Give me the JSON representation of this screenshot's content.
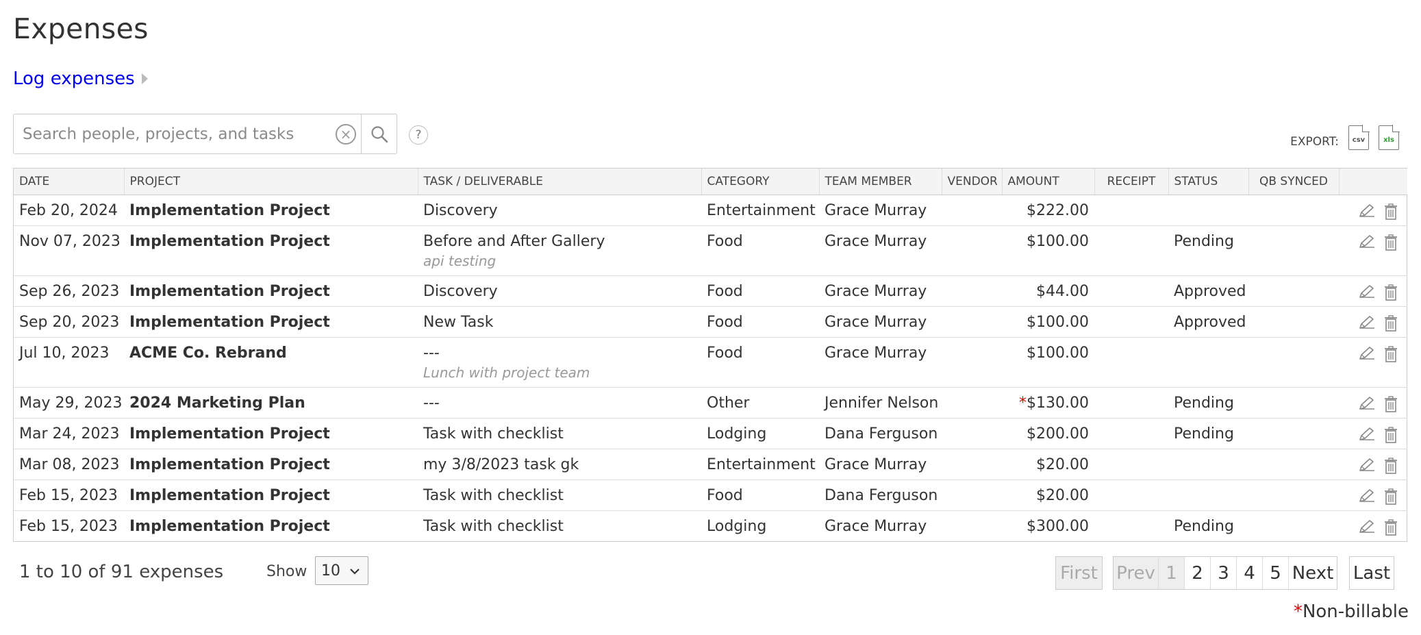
{
  "page": {
    "title": "Expenses",
    "log_link": "Log expenses"
  },
  "search": {
    "placeholder": "Search people, projects, and tasks",
    "help": "?"
  },
  "export": {
    "label": "EXPORT:",
    "csv": "csv",
    "xls": "xls"
  },
  "table": {
    "columns": {
      "date": "DATE",
      "project": "PROJECT",
      "task": "TASK / DELIVERABLE",
      "category": "CATEGORY",
      "member": "TEAM MEMBER",
      "vendor": "VENDOR",
      "amount": "AMOUNT",
      "receipt": "RECEIPT",
      "status": "STATUS",
      "qb": "QB SYNCED"
    },
    "rows": [
      {
        "date": "Feb 20, 2024",
        "project": "Implementation Project",
        "task": "Discovery",
        "note": "",
        "category": "Entertainment",
        "member": "Grace Murray",
        "vendor": "",
        "nonbillable": "",
        "amount": "$222.00",
        "receipt": "",
        "status": "",
        "qb": ""
      },
      {
        "date": "Nov 07, 2023",
        "project": "Implementation Project",
        "task": "Before and After Gallery",
        "note": "api testing",
        "category": "Food",
        "member": "Grace Murray",
        "vendor": "",
        "nonbillable": "",
        "amount": "$100.00",
        "receipt": "",
        "status": "Pending",
        "qb": ""
      },
      {
        "date": "Sep 26, 2023",
        "project": "Implementation Project",
        "task": "Discovery",
        "note": "",
        "category": "Food",
        "member": "Grace Murray",
        "vendor": "",
        "nonbillable": "",
        "amount": "$44.00",
        "receipt": "",
        "status": "Approved",
        "qb": ""
      },
      {
        "date": "Sep 20, 2023",
        "project": "Implementation Project",
        "task": "New Task",
        "note": "",
        "category": "Food",
        "member": "Grace Murray",
        "vendor": "",
        "nonbillable": "",
        "amount": "$100.00",
        "receipt": "",
        "status": "Approved",
        "qb": ""
      },
      {
        "date": "Jul 10, 2023",
        "project": "ACME Co. Rebrand",
        "task": "---",
        "note": "Lunch with project team",
        "category": "Food",
        "member": "Grace Murray",
        "vendor": "",
        "nonbillable": "",
        "amount": "$100.00",
        "receipt": "",
        "status": "",
        "qb": ""
      },
      {
        "date": "May 29, 2023",
        "project": "2024 Marketing Plan",
        "task": "---",
        "note": "",
        "category": "Other",
        "member": "Jennifer Nelson",
        "vendor": "",
        "nonbillable": "*",
        "amount": "$130.00",
        "receipt": "",
        "status": "Pending",
        "qb": ""
      },
      {
        "date": "Mar 24, 2023",
        "project": "Implementation Project",
        "task": "Task with checklist",
        "note": "",
        "category": "Lodging",
        "member": "Dana Ferguson",
        "vendor": "",
        "nonbillable": "",
        "amount": "$200.00",
        "receipt": "",
        "status": "Pending",
        "qb": ""
      },
      {
        "date": "Mar 08, 2023",
        "project": "Implementation Project",
        "task": "my 3/8/2023 task gk",
        "note": "",
        "category": "Entertainment",
        "member": "Grace Murray",
        "vendor": "",
        "nonbillable": "",
        "amount": "$20.00",
        "receipt": "",
        "status": "",
        "qb": ""
      },
      {
        "date": "Feb 15, 2023",
        "project": "Implementation Project",
        "task": "Task with checklist",
        "note": "",
        "category": "Food",
        "member": "Dana Ferguson",
        "vendor": "",
        "nonbillable": "",
        "amount": "$20.00",
        "receipt": "",
        "status": "",
        "qb": ""
      },
      {
        "date": "Feb 15, 2023",
        "project": "Implementation Project",
        "task": "Task with checklist",
        "note": "",
        "category": "Lodging",
        "member": "Grace Murray",
        "vendor": "",
        "nonbillable": "",
        "amount": "$300.00",
        "receipt": "",
        "status": "Pending",
        "qb": ""
      }
    ]
  },
  "footer": {
    "summary": "1 to 10 of 91 expenses",
    "show_label": "Show",
    "show_value": "10",
    "legend_star": "*",
    "legend_text": "Non-billable"
  },
  "pagination": {
    "first": "First",
    "prev": "Prev",
    "pages": [
      "1",
      "2",
      "3",
      "4",
      "5"
    ],
    "next": "Next",
    "last": "Last"
  },
  "icons": {
    "search": "search-icon",
    "clear": "clear-circle-icon",
    "help": "help-icon",
    "csv": "csv-file-icon",
    "xls": "xls-file-icon",
    "edit": "pencil-icon",
    "delete": "trash-icon"
  },
  "colors": {
    "link": "#0000ee",
    "nonbillable": "#e00000",
    "note": "#999999",
    "header_bg": "#f4f4f4"
  }
}
